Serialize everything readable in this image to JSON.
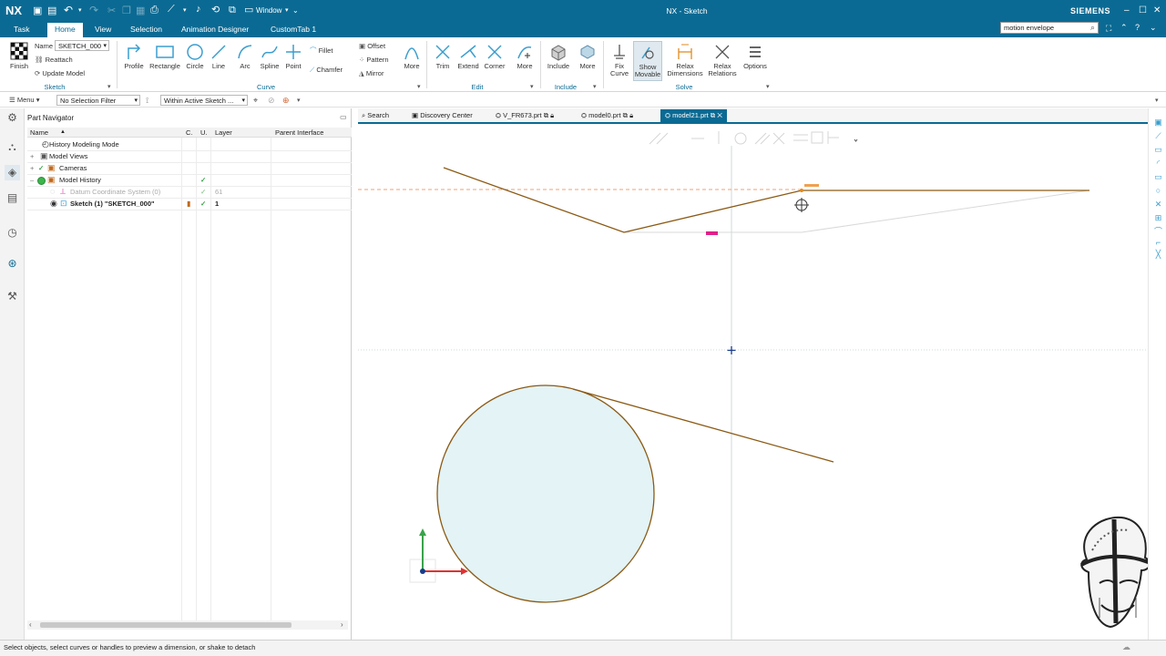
{
  "window": {
    "logo": "NX",
    "title": "NX - Sketch",
    "brand": "SIEMENS",
    "window_menu": "Window",
    "search_value": "motion envelope"
  },
  "menu_tabs": [
    "Task",
    "Home",
    "View",
    "Selection",
    "Animation Designer",
    "CustomTab 1"
  ],
  "ribbon": {
    "finish": "Finish",
    "name_label": "Name",
    "name_value": "SKETCH_000",
    "reattach": "Reattach",
    "update_model": "Update Model",
    "sketch_group": "Sketch",
    "curve_tools": [
      "Profile",
      "Rectangle",
      "Circle",
      "Line",
      "Arc",
      "Spline",
      "Point"
    ],
    "fillet": "Fillet",
    "chamfer": "Chamfer",
    "offset": "Offset",
    "pattern": "Pattern",
    "mirror": "Mirror",
    "more": "More",
    "curve_group": "Curve",
    "edit_tools": [
      "Trim",
      "Extend",
      "Corner"
    ],
    "edit_group": "Edit",
    "include": "Include",
    "include_group": "Include",
    "fix_curve": [
      "Fix",
      "Curve"
    ],
    "show_movable": [
      "Show",
      "Movable"
    ],
    "relax_dimensions": [
      "Relax",
      "Dimensions"
    ],
    "relax_relations": [
      "Relax",
      "Relations"
    ],
    "options": "Options",
    "solve_group": "Solve"
  },
  "filterbar": {
    "menu": "Menu",
    "selection_filter": "No Selection Filter",
    "scope": "Within Active Sketch ..."
  },
  "navigator": {
    "title": "Part Navigator",
    "columns": [
      "Name",
      "C.",
      "U.",
      "Layer",
      "Parent Interface"
    ],
    "rows": [
      {
        "name": "History Modeling Mode",
        "u": "",
        "layer": ""
      },
      {
        "name": "Model Views",
        "u": "",
        "layer": ""
      },
      {
        "name": "Cameras",
        "u": "",
        "layer": ""
      },
      {
        "name": "Model History",
        "u": "✓",
        "layer": ""
      },
      {
        "name": "Datum Coordinate System (0)",
        "u": "✓",
        "layer": "61"
      },
      {
        "name": "Sketch (1) \"SKETCH_000\"",
        "u": "✓",
        "layer": "1"
      }
    ]
  },
  "doc_tabs": [
    "Search",
    "Discovery Center",
    "V_FR673.prt",
    "model0.prt",
    "model21.prt"
  ],
  "status": "Select objects, select curves or handles to preview a dimension, or shake to detach",
  "colors": {
    "brand": "#0b6a93",
    "curve": "#8b5a14",
    "dimension_handle": "#e0208a",
    "circle_fill": "#e3f3f6"
  },
  "icons": [
    "save-icon",
    "undo-icon",
    "redo-icon",
    "search-icon",
    "minimize-icon",
    "maximize-icon",
    "close-icon",
    "lock-icon",
    "help-icon"
  ]
}
